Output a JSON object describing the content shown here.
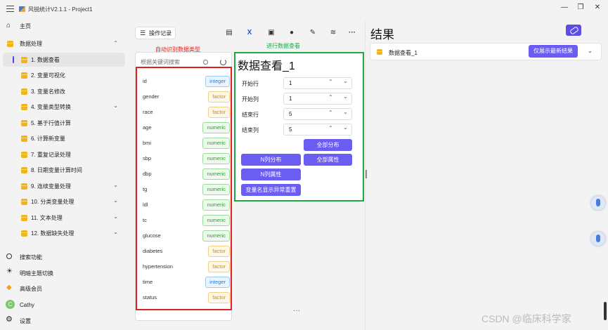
{
  "titlebar": {
    "title": "风锐统计V2.1.1 - Project1",
    "minimize": "—",
    "maximize": "❐",
    "close": "✕"
  },
  "sidebar": {
    "home": "主页",
    "data_processing": "数据处理",
    "items": [
      {
        "label": "1. 数据查看",
        "chevron": ""
      },
      {
        "label": "2. 变量可视化",
        "chevron": ""
      },
      {
        "label": "3. 变量名修改",
        "chevron": ""
      },
      {
        "label": "4. 变量类型转换",
        "chevron": "⌄"
      },
      {
        "label": "5. 基于行值计算",
        "chevron": ""
      },
      {
        "label": "6. 计算新变量",
        "chevron": ""
      },
      {
        "label": "7. 重复记录处理",
        "chevron": ""
      },
      {
        "label": "8. 日期变量计算时间",
        "chevron": ""
      },
      {
        "label": "9. 连续变量处理",
        "chevron": "⌄"
      },
      {
        "label": "10. 分类变量处理",
        "chevron": "⌄"
      },
      {
        "label": "11. 文本处理",
        "chevron": "⌄"
      },
      {
        "label": "12. 数据缺失处理",
        "chevron": "⌄"
      }
    ],
    "search": "搜索功能",
    "theme": "明暗主题切换",
    "vip": "高级会员",
    "user": "Cathy",
    "avatar": "C",
    "settings": "设置"
  },
  "toolbar": {
    "history": "操作记录",
    "more": "···"
  },
  "variables": {
    "search_placeholder": "根据关键词搜索",
    "annotation": "自动识别数据类型",
    "rows": [
      {
        "name": "id",
        "type": "integer"
      },
      {
        "name": "gender",
        "type": "factor"
      },
      {
        "name": "race",
        "type": "factor"
      },
      {
        "name": "age",
        "type": "numeric"
      },
      {
        "name": "bmi",
        "type": "numeric"
      },
      {
        "name": "sbp",
        "type": "numeric"
      },
      {
        "name": "dbp",
        "type": "numeric"
      },
      {
        "name": "tg",
        "type": "numeric"
      },
      {
        "name": "ldl",
        "type": "numeric"
      },
      {
        "name": "tc",
        "type": "numeric"
      },
      {
        "name": "glucose",
        "type": "numeric"
      },
      {
        "name": "diabetes",
        "type": "factor"
      },
      {
        "name": "hypertension",
        "type": "factor"
      },
      {
        "name": "time",
        "type": "integer"
      },
      {
        "name": "status",
        "type": "factor"
      }
    ]
  },
  "viewer": {
    "annotation": "进行数据查看",
    "title": "数据查看_1",
    "fields": [
      {
        "label": "开始行",
        "value": "1"
      },
      {
        "label": "开始列",
        "value": "1"
      },
      {
        "label": "结束行",
        "value": "5"
      },
      {
        "label": "结束列",
        "value": "5"
      }
    ],
    "buttons": {
      "all_dist": "全部分布",
      "n_col_dist": "N列分布",
      "all_attr": "全部属性",
      "n_col_attr": "N列属性",
      "rename_reset": "变量名显示异常重置"
    },
    "pager_dots": "···"
  },
  "results": {
    "title": "结果",
    "item": "数据查看_1",
    "latest_button": "仅展示最新结果",
    "chevron": "⌄"
  },
  "watermark": "CSDN @临床科学家"
}
